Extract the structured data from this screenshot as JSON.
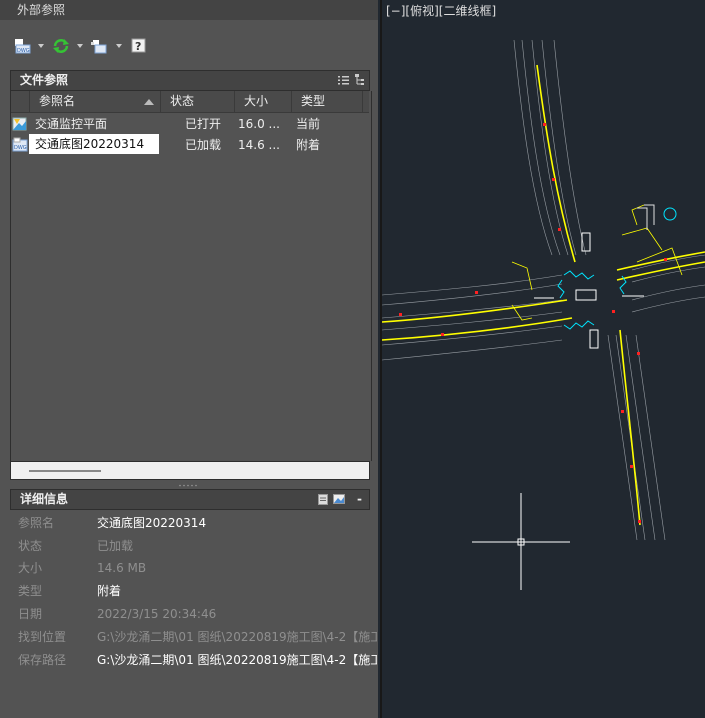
{
  "palette": {
    "title": "外部参照",
    "toolbar": {
      "attach_icon": "attach-dwg-icon",
      "refresh_icon": "refresh-icon",
      "change_path_icon": "change-path-icon",
      "help_icon": "help-icon"
    },
    "file_refs": {
      "header": "文件参照",
      "columns": [
        "参照名",
        "状态",
        "大小",
        "类型"
      ],
      "rows": [
        {
          "name": "交通监控平面",
          "status": "已打开",
          "size": "16.0 ...",
          "type": "当前",
          "icon": "drawing-icon",
          "selected": false
        },
        {
          "name": "交通底图20220314",
          "status": "已加载",
          "size": "14.6 ...",
          "type": "附着",
          "icon": "dwg-file-icon",
          "selected": true
        }
      ]
    },
    "details": {
      "header": "详细信息",
      "rows": [
        {
          "key": "参照名",
          "value": "交通底图20220314",
          "bright": true
        },
        {
          "key": "状态",
          "value": "已加载",
          "bright": false
        },
        {
          "key": "大小",
          "value": "14.6 MB",
          "bright": false
        },
        {
          "key": "类型",
          "value": "附着",
          "bright": true
        },
        {
          "key": "日期",
          "value": "2022/3/15 20:34:46",
          "bright": false
        },
        {
          "key": "找到位置",
          "value": "G:\\沙龙涌二期\\01 图纸\\20220819施工图\\4-2【施工",
          "bright": false
        },
        {
          "key": "保存路径",
          "value": "G:\\沙龙涌二期\\01 图纸\\20220819施工图\\4-2【施工",
          "bright": true
        }
      ]
    }
  },
  "viewport": {
    "label": "[−][俯视][二维线框]",
    "colors": {
      "background": "#212830",
      "roads": "#ffff00",
      "accent": "#00e5ff",
      "markers": "#ff2020",
      "lines": "#c0c0c0"
    }
  }
}
